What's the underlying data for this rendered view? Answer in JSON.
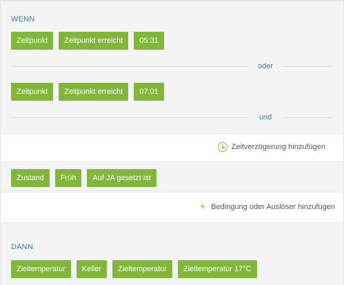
{
  "wenn": {
    "label": "WENN",
    "rule1": [
      "Zeitpunkt",
      "Zeitpunkt erreicht",
      "05:31"
    ],
    "or_label": "oder",
    "rule2": [
      "Zeitpunkt",
      "Zeitpunkt erreicht",
      "07:01"
    ],
    "and_label": "und",
    "add_delay": "Zeitverzögerung hinzufügen",
    "rule3": [
      "Zustand",
      "Früh",
      "Auf JA gesetzt ist"
    ],
    "add_condition": "Bedingung oder Auslöser hinzufügen"
  },
  "dann": {
    "label": "DANN",
    "action1": [
      "Zieltemperatur",
      "Keller",
      "Zieltemperatur",
      "Zieltemperatur 17°C"
    ]
  },
  "colors": {
    "chip": "#80b73a",
    "accent_text": "#3a7ba6"
  },
  "icons": {
    "delay": "clock-icon",
    "add": "plus-icon"
  }
}
